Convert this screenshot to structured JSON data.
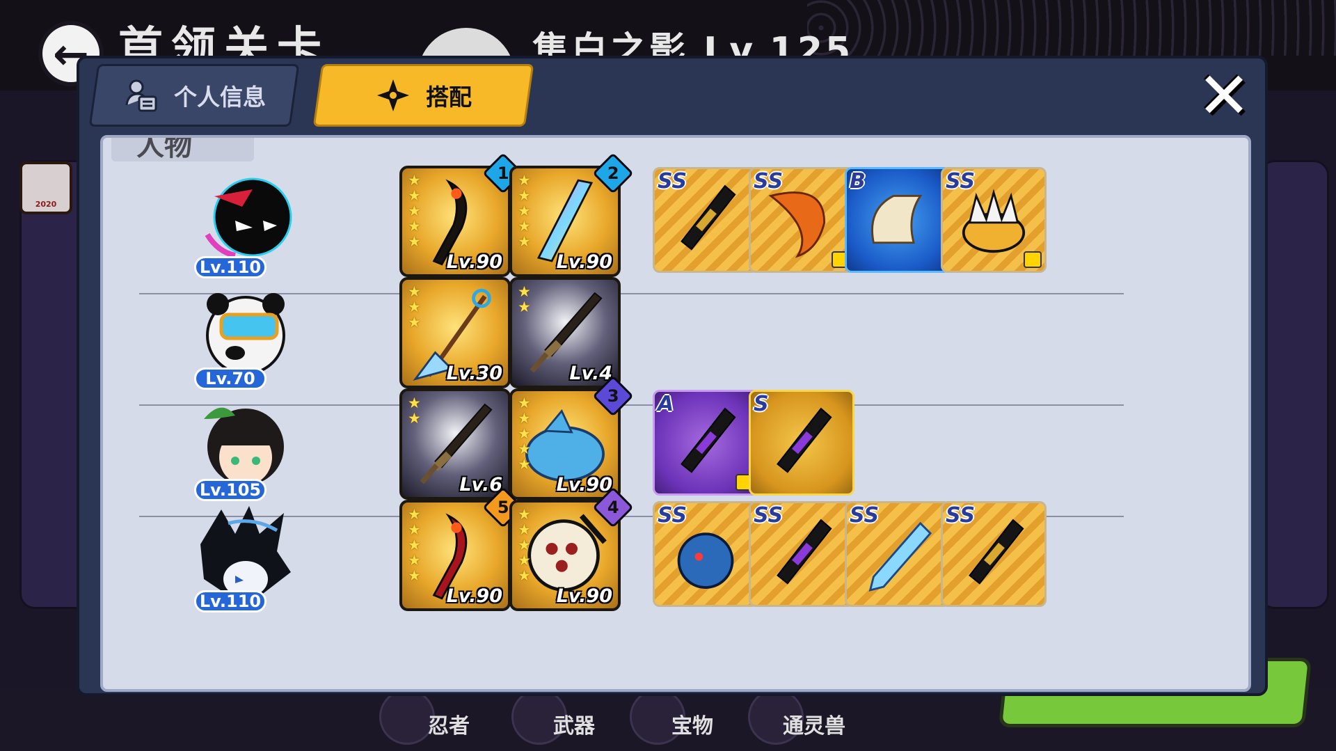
{
  "background": {
    "title": "首领关卡",
    "player_name": "隼白之影 Lv.125",
    "year_badge": "2020",
    "nav": [
      "忍者",
      "武器",
      "宝物",
      "通灵兽"
    ]
  },
  "dialog": {
    "tabs": [
      {
        "label": "个人信息",
        "active": false,
        "icon": "person-card-icon"
      },
      {
        "label": "搭配",
        "active": true,
        "icon": "shuriken-star-icon"
      }
    ],
    "close_icon": "close-x-icon",
    "section_label": "人物"
  },
  "heroes": [
    {
      "level": "Lv.110",
      "avatar": "black-stickman-ninja",
      "weapons": [
        {
          "level": "Lv.90",
          "stars": 5,
          "slot": "1",
          "slot_color": "#1ea7e8",
          "style": "gold",
          "icon": "dark-scythe-icon"
        },
        {
          "level": "Lv.90",
          "stars": 5,
          "slot": "2",
          "slot_color": "#1ea7e8",
          "style": "gold",
          "icon": "rainbow-blade-icon"
        }
      ],
      "treasures": [
        {
          "grade": "SS",
          "style": "swirl",
          "icon": "black-scroll-icon",
          "shirt": false
        },
        {
          "grade": "SS",
          "style": "swirl",
          "icon": "fire-horn-icon",
          "shirt": true
        },
        {
          "grade": "B",
          "style": "blue",
          "icon": "paper-scroll-icon",
          "shirt": false
        },
        {
          "grade": "SS",
          "style": "swirl",
          "icon": "spiked-crown-icon",
          "shirt": true
        }
      ]
    },
    {
      "level": "Lv.70",
      "avatar": "panda-goggles-ninja",
      "weapons": [
        {
          "level": "Lv.30",
          "stars": 3,
          "slot": "",
          "slot_color": "",
          "style": "gold",
          "icon": "ice-spear-icon"
        },
        {
          "level": "Lv.4",
          "stars": 2,
          "slot": "",
          "slot_color": "",
          "style": "dark",
          "icon": "bronze-sword-icon"
        }
      ],
      "treasures": []
    },
    {
      "level": "Lv.105",
      "avatar": "leaf-hair-girl-ninja",
      "weapons": [
        {
          "level": "Lv.6",
          "stars": 2,
          "slot": "",
          "slot_color": "",
          "style": "dark",
          "icon": "bronze-sword-icon"
        },
        {
          "level": "Lv.90",
          "stars": 5,
          "slot": "3",
          "slot_color": "#5b4ad8",
          "style": "gold",
          "icon": "blue-shark-icon"
        }
      ],
      "treasures": [
        {
          "grade": "A",
          "style": "purple",
          "icon": "purple-blade-scroll-icon",
          "shirt": true
        },
        {
          "grade": "S",
          "style": "gold",
          "icon": "lightning-tube-icon",
          "shirt": false
        }
      ]
    },
    {
      "level": "Lv.110",
      "avatar": "spiky-hair-mask-ninja",
      "weapons": [
        {
          "level": "Lv.90",
          "stars": 5,
          "slot": "5",
          "slot_color": "#f39a1e",
          "style": "gold",
          "icon": "red-scythe-icon"
        },
        {
          "level": "Lv.90",
          "stars": 5,
          "slot": "4",
          "slot_color": "#8a58d8",
          "style": "gold",
          "icon": "war-drum-icon"
        }
      ],
      "treasures": [
        {
          "grade": "SS",
          "style": "swirl",
          "icon": "blue-beast-icon",
          "shirt": false
        },
        {
          "grade": "SS",
          "style": "swirl",
          "icon": "purple-hilt-icon",
          "shirt": false
        },
        {
          "grade": "SS",
          "style": "swirl",
          "icon": "crystal-kunai-icon",
          "shirt": false
        },
        {
          "grade": "SS",
          "style": "swirl",
          "icon": "black-scroll-icon",
          "shirt": false
        }
      ]
    }
  ]
}
